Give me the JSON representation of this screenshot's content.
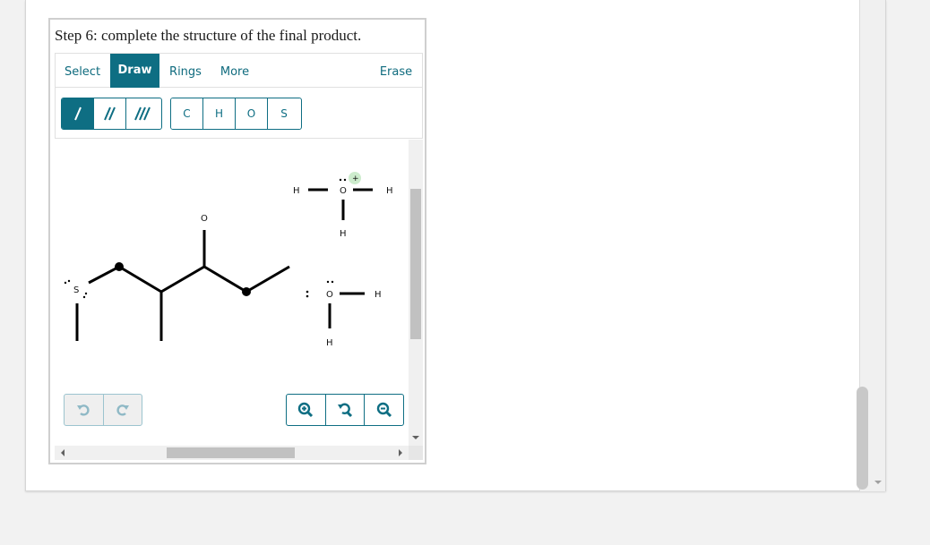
{
  "question": {
    "title": "Step 6: complete the structure of the final product."
  },
  "editor": {
    "tabs": [
      {
        "label": "Select",
        "active": false
      },
      {
        "label": "Draw",
        "active": true
      },
      {
        "label": "Rings",
        "active": false
      },
      {
        "label": "More",
        "active": false
      }
    ],
    "erase_label": "Erase",
    "bond_tools": [
      {
        "name": "single-bond",
        "icon": "single-bond-icon",
        "active": true
      },
      {
        "name": "double-bond",
        "icon": "double-bond-icon",
        "active": false
      },
      {
        "name": "triple-bond",
        "icon": "triple-bond-icon",
        "active": false
      }
    ],
    "atom_tools": [
      "C",
      "H",
      "O",
      "S"
    ],
    "undo_icon": "undo-icon",
    "redo_icon": "redo-icon",
    "zoom_tools": [
      "zoom-in-icon",
      "zoom-reset-icon",
      "zoom-out-icon"
    ]
  },
  "molecule": {
    "atoms": {
      "sulfur": "S",
      "carbonyl_oxygen": "O",
      "hydronium_oxygen": "O",
      "hydronium_h_left": "H",
      "hydronium_h_right": "H",
      "hydronium_h_bottom": "H",
      "hydronium_charge": "+",
      "water_oxygen": "O",
      "water_h_right": "H",
      "water_h_bottom": "H"
    }
  },
  "colors": {
    "accent": "#0e6e83",
    "charge_bubble": "#cdeccd",
    "disabled_border": "#9cc4cf"
  }
}
